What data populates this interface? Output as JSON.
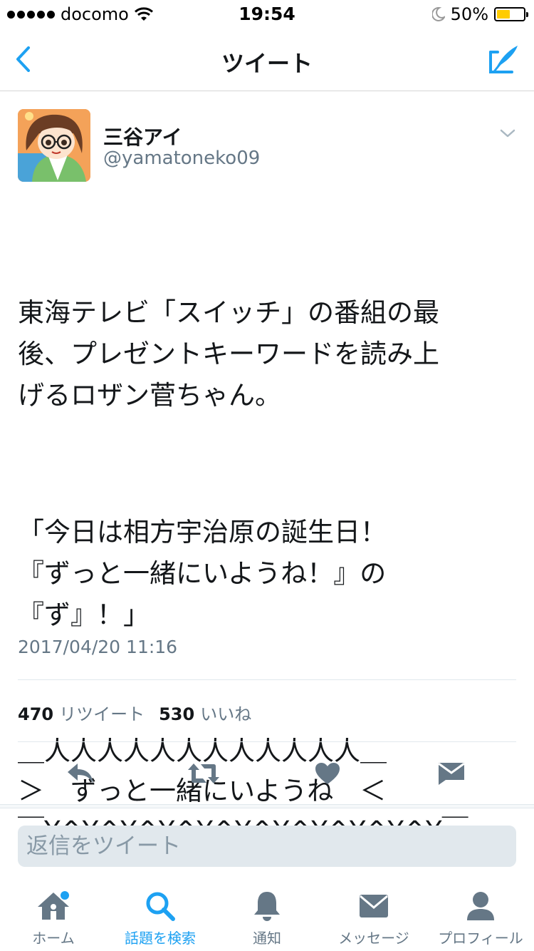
{
  "status_bar": {
    "carrier": "docomo",
    "time": "19:54",
    "battery_percent": "50%",
    "battery_level": 0.5,
    "icons": [
      "signal-dots",
      "wifi-icon",
      "moon-icon",
      "battery-icon"
    ]
  },
  "nav": {
    "title": "ツイート",
    "back_icon": "chevron-left-icon",
    "compose_icon": "compose-tweet-icon"
  },
  "tweet": {
    "author_name": "三谷アイ",
    "author_handle": "@yamatoneko09",
    "paragraphs": [
      "東海テレビ「スイッチ」の番組の最\n後、プレゼントキーワードを読み上\nげるロザン菅ちゃん。",
      "「今日は相方宇治原の誕生日！\n『ずっと一緒にいようね！』の\n『ず』！」",
      "＿人人人人人人人人人人人人＿\n＞　ずっと一緒にいようね　＜\n￣Y^Y^Y^Y^Y^Y^Y^Y^Y^Y^Y￣"
    ],
    "timestamp": "2017/04/20 11:16",
    "retweet_count": "470",
    "retweet_label": "リツイート",
    "like_count": "530",
    "like_label": "いいね"
  },
  "actions": [
    "reply-icon",
    "retweet-icon",
    "like-icon",
    "direct-message-icon"
  ],
  "reply": {
    "placeholder": "返信をツイート"
  },
  "tabs": [
    {
      "label": "ホーム",
      "icon": "home-icon",
      "active": false,
      "has_notification": true
    },
    {
      "label": "話題を検索",
      "icon": "search-icon",
      "active": true,
      "has_notification": false
    },
    {
      "label": "通知",
      "icon": "bell-icon",
      "active": false,
      "has_notification": false
    },
    {
      "label": "メッセージ",
      "icon": "envelope-icon",
      "active": false,
      "has_notification": false
    },
    {
      "label": "プロフィール",
      "icon": "person-icon",
      "active": false,
      "has_notification": false
    }
  ],
  "colors": {
    "accent": "#1da1f2",
    "text": "#14171a",
    "secondary": "#657786",
    "icon_gray": "#657786",
    "battery": "#ffcc00"
  }
}
